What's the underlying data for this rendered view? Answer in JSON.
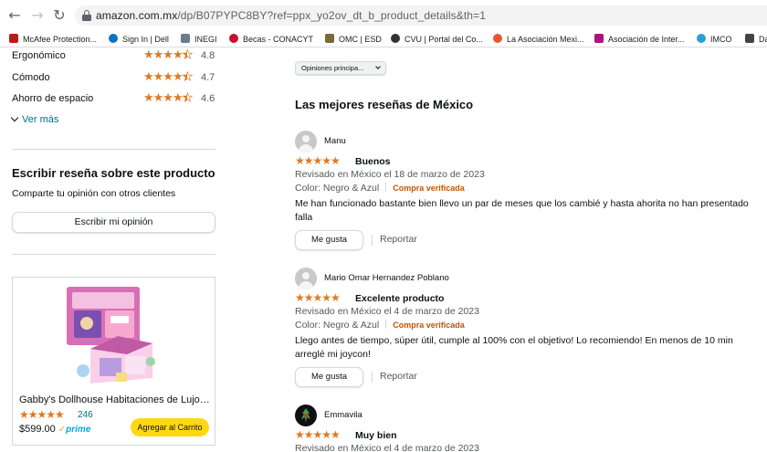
{
  "browser": {
    "url_host": "amazon.com.mx",
    "url_path": "/dp/B07PYPC8BY?ref=ppx_yo2ov_dt_b_product_details&th=1",
    "bookmarks": [
      {
        "label": "McAfee Protection...",
        "color": "#c01818"
      },
      {
        "label": "Sign In | Dell",
        "color": "#0b74c4"
      },
      {
        "label": "INEGI",
        "color": "#6b7d8c"
      },
      {
        "label": "Becas - CONACYT",
        "color": "#c8102e"
      },
      {
        "label": "OMC | ESD",
        "color": "#7a6a3a"
      },
      {
        "label": "CVU | Portal del Co...",
        "color": "#333333"
      },
      {
        "label": "La Asociación Mexi...",
        "color": "#e4572e"
      },
      {
        "label": "Asociación de Inter...",
        "color": "#b0127f"
      },
      {
        "label": "IMCO",
        "color": "#2a9fd6"
      },
      {
        "label": "Da",
        "color": "#444444"
      }
    ]
  },
  "features": [
    {
      "label": "Ergonómico",
      "value": "4.8",
      "rating": 4.8
    },
    {
      "label": "Cómodo",
      "value": "4.7",
      "rating": 4.7
    },
    {
      "label": "Ahorro de espacio",
      "value": "4.6",
      "rating": 4.6
    }
  ],
  "ver_mas": "Ver más",
  "write_review": {
    "title": "Escribir reseña sobre este producto",
    "subtitle": "Comparte tu opinión con otros clientes",
    "button": "Escribir mi opinión"
  },
  "ad": {
    "title": "Gabby's Dollhouse Habitaciones de Lujo –...",
    "rating": 5,
    "rating_count": "246",
    "price": "$599.00",
    "prime": "prime",
    "cart_button": "Agregar al Carrito"
  },
  "sort": {
    "selected": "Opiniones principa..."
  },
  "reviews_title": "Las mejores reseñas de México",
  "reviews": [
    {
      "author": "Manu",
      "avatar": "default",
      "rating": 5,
      "title": "Buenos",
      "date": "Revisado en México el 18 de marzo de 2023",
      "color": "Color: Negro & Azul",
      "verified": "Compra verificada",
      "body": "Me han funcionado bastante bien llevo un par de meses que los cambié y hasta ahorita no han presentado falla",
      "like": "Me gusta",
      "report": "Reportar"
    },
    {
      "author": "Mario Omar Hernandez Poblano",
      "avatar": "default",
      "rating": 5,
      "title": "Excelente producto",
      "date": "Revisado en México el 4 de marzo de 2023",
      "color": "Color: Negro & Azul",
      "verified": "Compra verificada",
      "body": "Llego antes de tiempo, súper útil, cumple al 100% con el objetivo! Lo recomiendo! En menos de 10 min arreglé mi joycon!",
      "like": "Me gusta",
      "report": "Reportar"
    },
    {
      "author": "Emmavila",
      "avatar": "custom",
      "rating": 5,
      "title": "Muy bien",
      "date": "Revisado en México el 4 de marzo de 2023"
    }
  ]
}
